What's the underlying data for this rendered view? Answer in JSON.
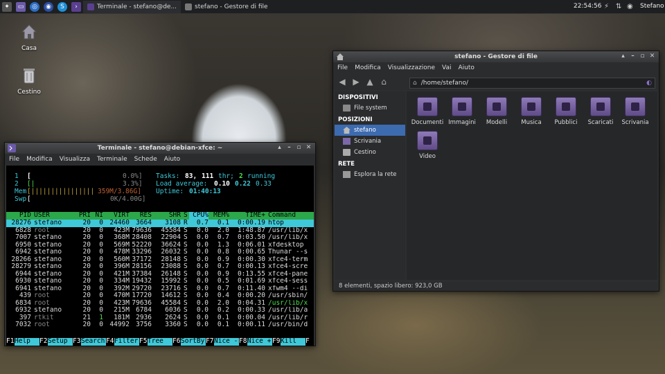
{
  "panel": {
    "tasks": [
      {
        "label": "Terminale - stefano@de..."
      },
      {
        "label": "stefano - Gestore di file"
      }
    ],
    "clock": "22:54:56",
    "user": "Stefano"
  },
  "desktop": {
    "icons": [
      {
        "label": "Casa"
      },
      {
        "label": "Cestino"
      }
    ]
  },
  "terminal": {
    "title": "Terminale - stefano@debian-xfce: ~",
    "menu": [
      "File",
      "Modifica",
      "Visualizza",
      "Terminale",
      "Schede",
      "Aiuto"
    ],
    "htop": {
      "cpu1": {
        "label": "1",
        "bar": "[",
        "pct": "0.0%]"
      },
      "cpu2": {
        "label": "2",
        "bar": "[|",
        "pct": "3.3%]"
      },
      "mem": {
        "label": "Mem",
        "bar": "[||||||||||||||||",
        "val": "359M/3.86G]"
      },
      "swp": {
        "label": "Swp",
        "bar": "[",
        "val": "0K/4.00G]"
      },
      "tasks_label": "Tasks:",
      "tasks": "83,",
      "thr_n": "111",
      "thr": "thr;",
      "running_n": "2",
      "running": "running",
      "load_label": "Load average:",
      "load1": "0.10",
      "load5": "0.22",
      "load15": "0.33",
      "uptime_label": "Uptime:",
      "uptime": "01:40:13",
      "headers": [
        "PID",
        "USER",
        "PRI",
        "NI",
        "VIRT",
        "RES",
        "SHR",
        "S",
        "CPU%",
        "MEM%",
        "TIME+",
        "Command"
      ],
      "rows": [
        [
          "28276",
          "stefano",
          "20",
          "0",
          "24460",
          "3664",
          "3108",
          "R",
          "0.7",
          "0.1",
          "0:00.19",
          "htop"
        ],
        [
          "6828",
          "root",
          "20",
          "0",
          "423M",
          "79636",
          "45584",
          "S",
          "0.0",
          "2.0",
          "1:48.87",
          "/usr/lib/x"
        ],
        [
          "7007",
          "stefano",
          "20",
          "0",
          "368M",
          "28408",
          "22904",
          "S",
          "0.0",
          "0.7",
          "0:03.50",
          "/usr/lib/x"
        ],
        [
          "6950",
          "stefano",
          "20",
          "0",
          "569M",
          "52220",
          "36624",
          "S",
          "0.0",
          "1.3",
          "0:06.01",
          "xfdesktop"
        ],
        [
          "6942",
          "stefano",
          "20",
          "0",
          "478M",
          "33296",
          "26032",
          "S",
          "0.0",
          "0.8",
          "0:00.65",
          "Thunar --s"
        ],
        [
          "28266",
          "stefano",
          "20",
          "0",
          "560M",
          "37172",
          "28148",
          "S",
          "0.0",
          "0.9",
          "0:00.30",
          "xfce4-term"
        ],
        [
          "28279",
          "stefano",
          "20",
          "0",
          "396M",
          "28156",
          "23088",
          "S",
          "0.0",
          "0.7",
          "0:00.13",
          "xfce4-scre"
        ],
        [
          "6944",
          "stefano",
          "20",
          "0",
          "421M",
          "37384",
          "26148",
          "S",
          "0.0",
          "0.9",
          "0:13.55",
          "xfce4-pane"
        ],
        [
          "6930",
          "stefano",
          "20",
          "0",
          "334M",
          "19432",
          "15992",
          "S",
          "0.0",
          "0.5",
          "0:01.69",
          "xfce4-sess"
        ],
        [
          "6941",
          "stefano",
          "20",
          "0",
          "392M",
          "29720",
          "23716",
          "S",
          "0.0",
          "0.7",
          "0:11.40",
          "xfwm4 --di"
        ],
        [
          "439",
          "root",
          "20",
          "0",
          "470M",
          "17720",
          "14612",
          "S",
          "0.0",
          "0.4",
          "0:00.20",
          "/usr/sbin/"
        ],
        [
          "6834",
          "root",
          "20",
          "0",
          "423M",
          "79636",
          "45584",
          "S",
          "0.0",
          "2.0",
          "0:04.31",
          "/usr/lib/x"
        ],
        [
          "6932",
          "stefano",
          "20",
          "0",
          "215M",
          "6784",
          "6036",
          "S",
          "0.0",
          "0.2",
          "0:00.33",
          "/usr/lib/a"
        ],
        [
          "397",
          "rtkit",
          "21",
          "1",
          "181M",
          "2936",
          "2624",
          "S",
          "0.0",
          "0.1",
          "0:00.04",
          "/usr/lib/r"
        ],
        [
          "7032",
          "root",
          "20",
          "0",
          "44992",
          "3756",
          "3360",
          "S",
          "0.0",
          "0.1",
          "0:00.11",
          "/usr/bin/d"
        ]
      ],
      "fkeys": [
        {
          "k": "F1",
          "l": "Help"
        },
        {
          "k": "F2",
          "l": "Setup"
        },
        {
          "k": "F3",
          "l": "Search"
        },
        {
          "k": "F4",
          "l": "Filter"
        },
        {
          "k": "F5",
          "l": "Tree"
        },
        {
          "k": "F6",
          "l": "SortBy"
        },
        {
          "k": "F7",
          "l": "Nice -"
        },
        {
          "k": "F8",
          "l": "Nice +"
        },
        {
          "k": "F9",
          "l": "Kill"
        },
        {
          "k": "F",
          "l": ""
        }
      ]
    }
  },
  "filemanager": {
    "title": "stefano - Gestore di file",
    "menu": [
      "File",
      "Modifica",
      "Visualizzazione",
      "Vai",
      "Aiuto"
    ],
    "location": "/home/stefano/",
    "sidebar": {
      "devices_header": "DISPOSITIVI",
      "devices": [
        {
          "label": "File system"
        }
      ],
      "places_header": "POSIZIONI",
      "places": [
        {
          "label": "stefano"
        },
        {
          "label": "Scrivania"
        },
        {
          "label": "Cestino"
        }
      ],
      "network_header": "RETE",
      "network": [
        {
          "label": "Esplora la rete"
        }
      ]
    },
    "items": [
      {
        "label": "Documenti"
      },
      {
        "label": "Immagini"
      },
      {
        "label": "Modelli"
      },
      {
        "label": "Musica"
      },
      {
        "label": "Pubblici"
      },
      {
        "label": "Scaricati"
      },
      {
        "label": "Scrivania"
      },
      {
        "label": "Video"
      }
    ],
    "status": "8 elementi, spazio libero: 923,0 GB"
  }
}
